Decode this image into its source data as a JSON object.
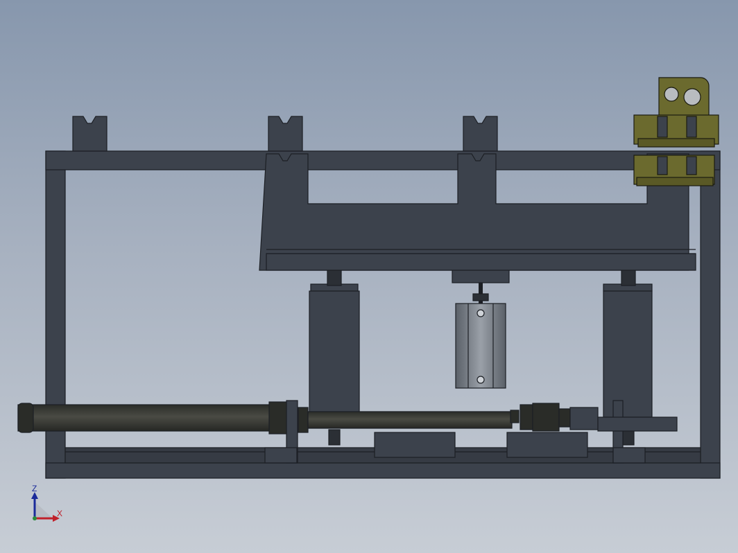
{
  "view": {
    "background_top": "#8797ad",
    "background_bottom": "#c7cdd5",
    "part_color": "#3c424c",
    "edge_color": "#1c1f24",
    "gripper_color": "#6b6a2e"
  },
  "triad": {
    "z_label": "Z",
    "x_label": "X",
    "z_color": "#1a2a9a",
    "x_color": "#c0202a"
  }
}
